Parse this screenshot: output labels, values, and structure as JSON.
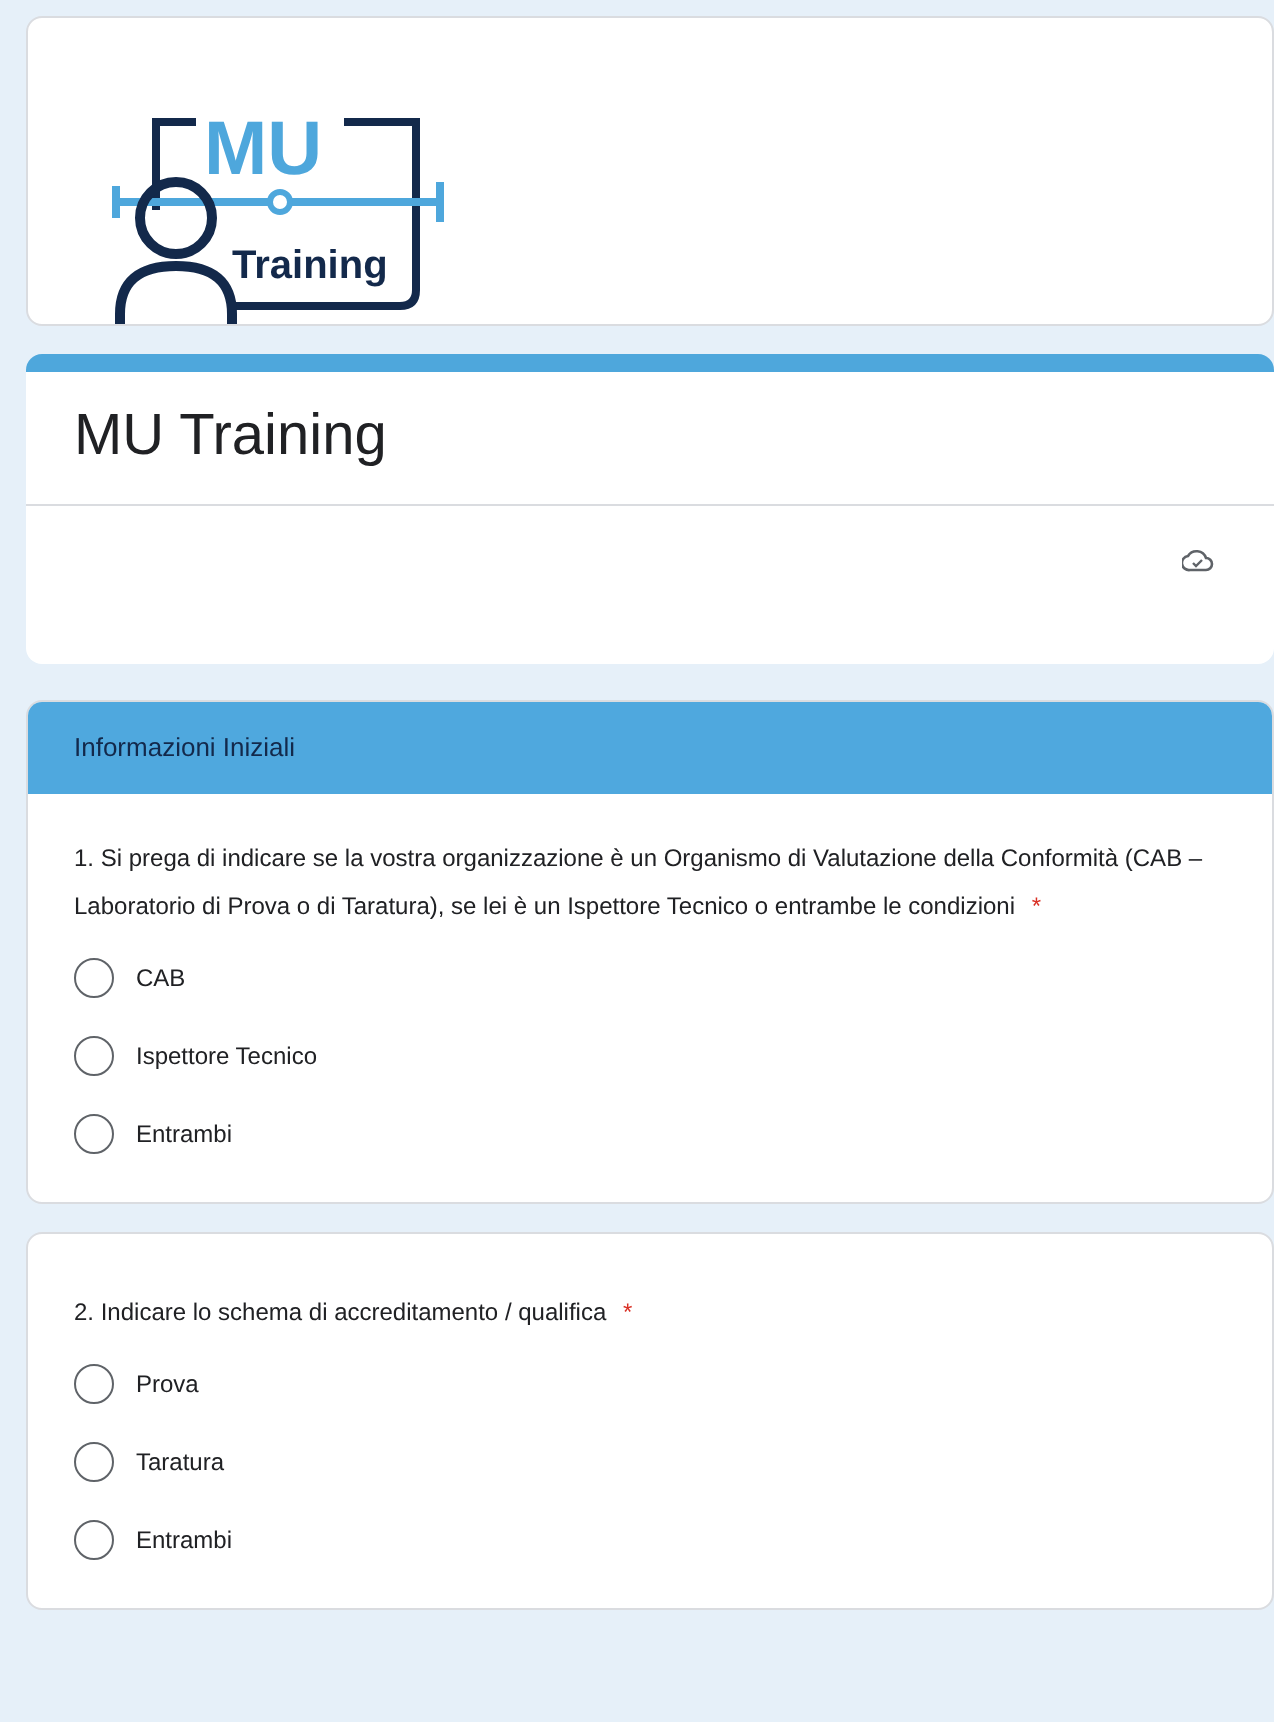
{
  "logo": {
    "top_text": "MU",
    "bottom_text": "Training"
  },
  "form": {
    "title": "MU Training"
  },
  "section": {
    "title": "Informazioni Iniziali"
  },
  "questions": [
    {
      "text": "1. Si prega di indicare se la vostra organizzazione è un Organismo di Valutazione della Conformità (CAB – Laboratorio di Prova o di Taratura), se lei è un Ispettore Tecnico o entrambe le condizioni",
      "required_mark": "*",
      "options": [
        {
          "label": "CAB",
          "selected": false
        },
        {
          "label": "Ispettore Tecnico",
          "selected": false
        },
        {
          "label": "Entrambi",
          "selected": false
        }
      ]
    },
    {
      "text": "2. Indicare lo schema di accreditamento  / qualifica",
      "required_mark": "*",
      "options": [
        {
          "label": "Prova",
          "selected": false
        },
        {
          "label": "Taratura",
          "selected": false
        },
        {
          "label": "Entrambi",
          "selected": false
        }
      ]
    }
  ]
}
